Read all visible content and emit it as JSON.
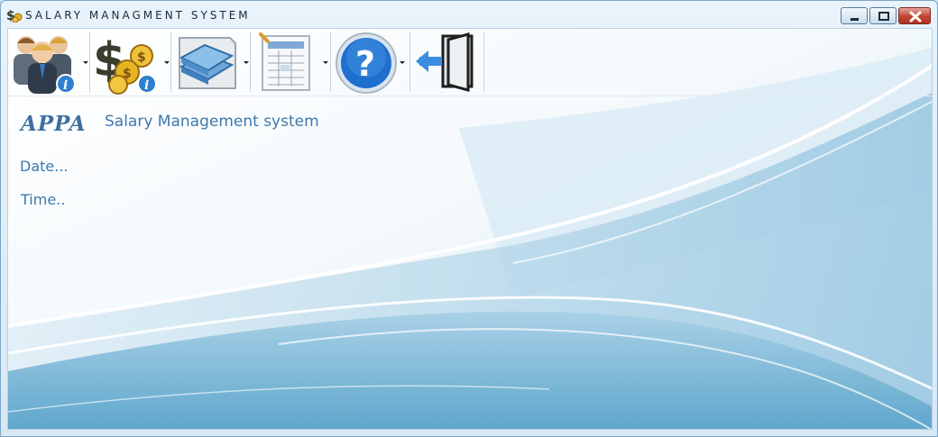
{
  "window": {
    "title": "SALARY MANAGMENT SYSTEM",
    "app_icon": "dollar-coins-icon",
    "controls": [
      "minimize-icon",
      "restore-icon",
      "close-icon"
    ]
  },
  "toolbar": {
    "items": [
      {
        "name": "employees-info-button",
        "icon": "employees-info-icon",
        "has_dropdown": true
      },
      {
        "name": "salary-info-button",
        "icon": "dollar-coins-info-icon",
        "has_dropdown": true
      },
      {
        "name": "books-button",
        "icon": "books-icon",
        "has_dropdown": true
      },
      {
        "name": "reports-button",
        "icon": "spreadsheet-icon",
        "has_dropdown": true
      },
      {
        "name": "help-button",
        "icon": "help-icon",
        "has_dropdown": true
      },
      {
        "name": "exit-button",
        "icon": "exit-door-icon",
        "has_dropdown": false
      }
    ]
  },
  "main": {
    "logo": "APPA",
    "heading": "Salary Management system",
    "date": "Date...",
    "time": "Time.."
  },
  "colors": {
    "text": "#3e78ab",
    "logo": "#3d6f9f",
    "background_wave": "#6aaed2",
    "close_button": "#c2432f"
  }
}
